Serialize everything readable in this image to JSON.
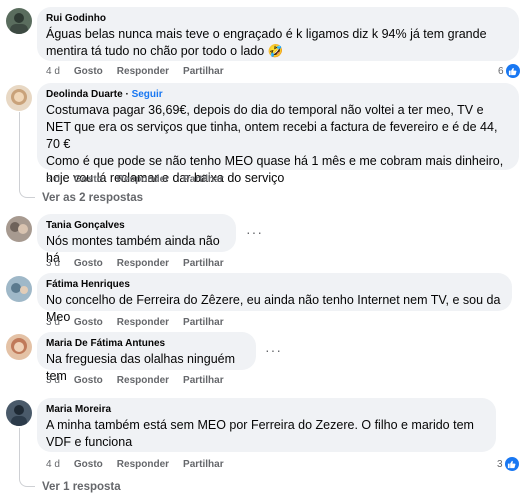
{
  "comments": [
    {
      "author": "Rui Godinho",
      "text": "Águas belas nunca mais teve o engraçado é k ligamos diz k 94% já tem grande mentira tá tudo no chão por todo o lado 🤣",
      "time": "4 d",
      "like": "Gosto",
      "reply": "Responder",
      "share": "Partilhar",
      "reaction_count": "6",
      "avatar_color": "#5a6d5e"
    },
    {
      "author": "Deolinda Duarte",
      "follow": "Seguir",
      "text": "Costumava pagar 36,69€, depois do dia do temporal não voltei a ter meo, TV e NET que era os serviços que tinha, ontem recebi a factura de fevereiro e é de 44, 70 €\nComo é que pode se não tenho MEO quase há 1 mês e me cobram mais dinheiro, hoje vou lá reclamar e dar baixa do serviço",
      "time": "3 d",
      "like": "Gosto",
      "reply": "Responder",
      "share": "Partilhar",
      "replies_label": "Ver as 2 respostas",
      "avatar_color": "#c9a27a"
    },
    {
      "author": "Tania Gonçalves",
      "text": "Nós montes também ainda não há",
      "time": "3 d",
      "like": "Gosto",
      "reply": "Responder",
      "share": "Partilhar",
      "avatar_color": "#8a7f78"
    },
    {
      "author": "Fátima Henriques",
      "text": "No concelho de Ferreira do Zêzere, eu ainda não tenho Internet nem TV, e sou da Meo",
      "time": "3 d",
      "like": "Gosto",
      "reply": "Responder",
      "share": "Partilhar",
      "avatar_color": "#7a9bb0"
    },
    {
      "author": "Maria De Fátima Antunes",
      "text": "Na freguesia das olalhas ninguém tem",
      "time": "3 d",
      "like": "Gosto",
      "reply": "Responder",
      "share": "Partilhar",
      "avatar_color": "#c07a5a"
    },
    {
      "author": "Maria Moreira",
      "text": "A minha também está sem MEO por Ferreira do Zezere. O filho e marido tem VDF e funciona",
      "time": "4 d",
      "like": "Gosto",
      "reply": "Responder",
      "share": "Partilhar",
      "reaction_count": "3",
      "replies_label": "Ver 1 resposta",
      "avatar_color": "#4a5a6a"
    }
  ],
  "colors": {
    "link": "#1877f2",
    "bubble": "#f0f2f5",
    "muted": "#65676b"
  },
  "icons": {
    "like": "thumbs-up-icon",
    "more": "more-options-icon"
  }
}
